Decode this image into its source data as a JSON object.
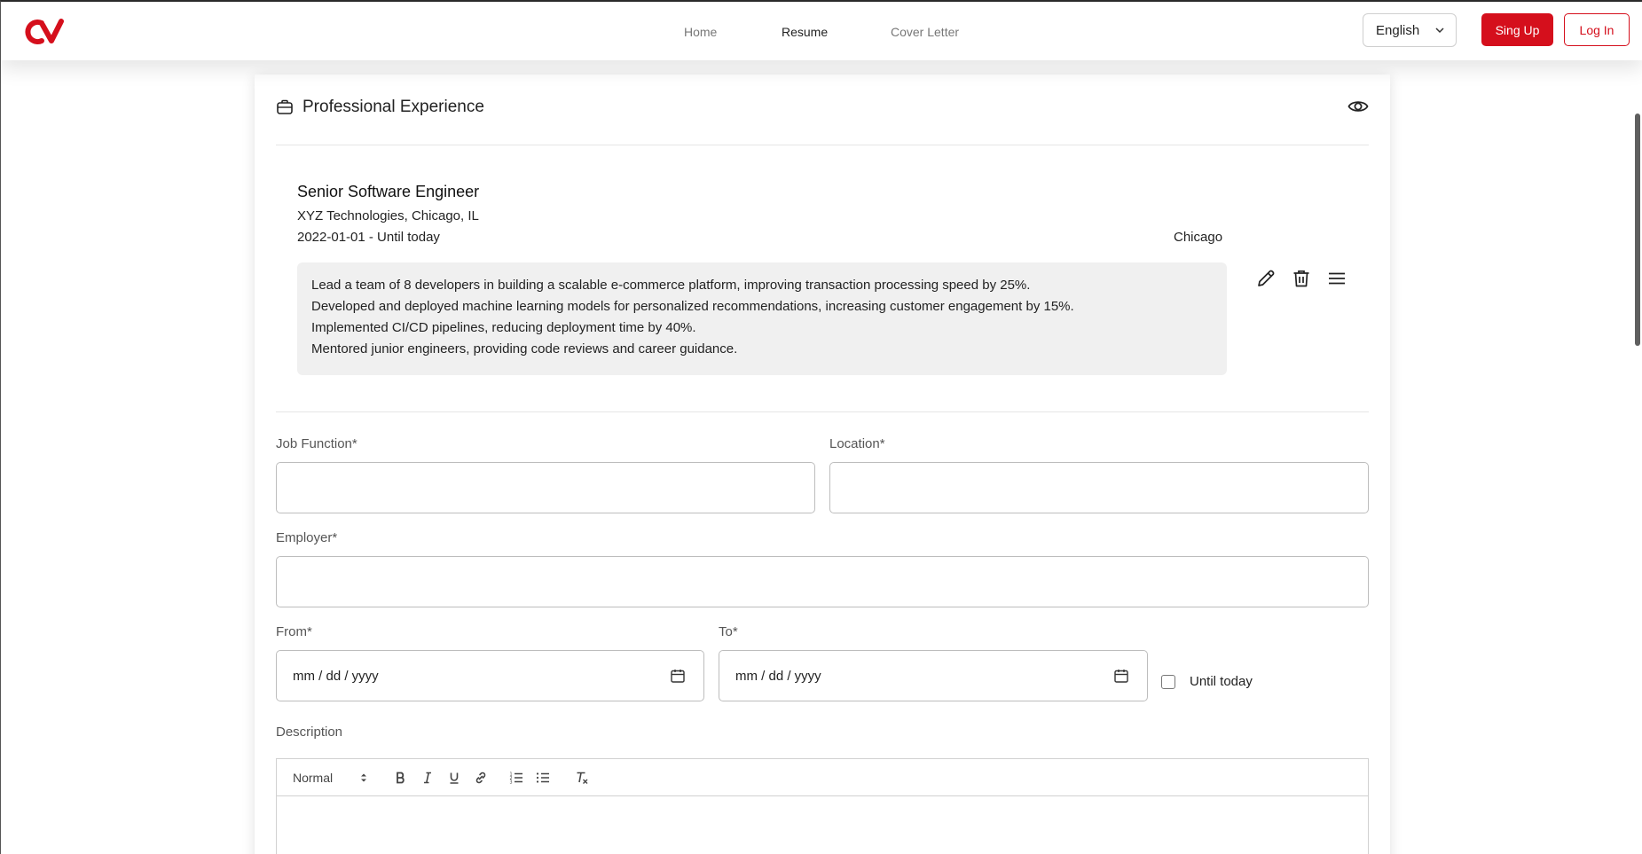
{
  "header": {
    "nav": [
      {
        "label": "Home",
        "active": false
      },
      {
        "label": "Resume",
        "active": true
      },
      {
        "label": "Cover Letter",
        "active": false
      }
    ],
    "language": "English",
    "signup_label": "Sing Up",
    "login_label": "Log In",
    "accent": "#d50f1c"
  },
  "section": {
    "title": "Professional Experience",
    "icons": {
      "section": "briefcase-icon",
      "visibility": "eye-icon"
    }
  },
  "entry": {
    "title": "Senior Software Engineer",
    "employer": "XYZ Technologies, Chicago, IL",
    "dates": "2022-01-01  -  Until today",
    "city": "Chicago",
    "description": [
      "Lead a team of 8 developers in building a scalable e-commerce platform, improving transaction processing speed by 25%.",
      "Developed and deployed machine learning models for personalized recommendations, increasing customer engagement by 15%.",
      "Implemented CI/CD pipelines, reducing deployment time by 40%.",
      "Mentored junior engineers, providing code reviews and career guidance."
    ],
    "actions": [
      "edit-icon",
      "trash-icon",
      "drag-handle-icon"
    ]
  },
  "form": {
    "job_function_label": "Job Function*",
    "job_function_value": "",
    "location_label": "Location*",
    "location_value": "",
    "employer_label": "Employer*",
    "employer_value": "",
    "from_label": "From*",
    "from_placeholder": "mm / dd / yyyy",
    "to_label": "To*",
    "to_placeholder": "mm / dd / yyyy",
    "until_today_label": "Until today",
    "until_today_checked": false,
    "description_label": "Description",
    "editor": {
      "heading_select": "Normal",
      "tools": [
        "bold-icon",
        "italic-icon",
        "underline-icon",
        "link-icon",
        "ordered-list-icon",
        "bullet-list-icon",
        "clear-format-icon"
      ]
    }
  }
}
